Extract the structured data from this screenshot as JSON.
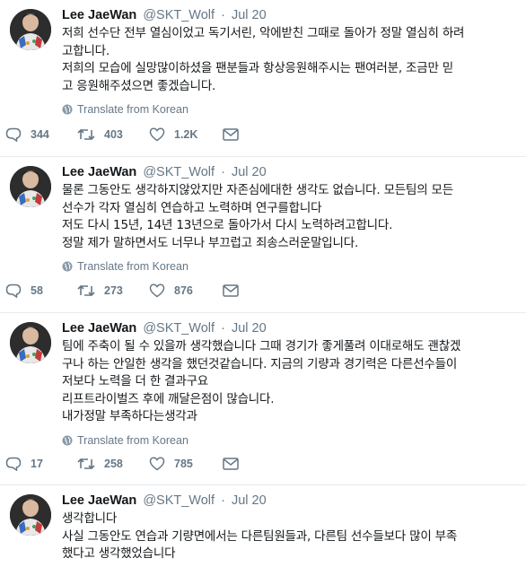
{
  "tweets": [
    {
      "name": "Lee JaeWan",
      "handle": "@SKT_Wolf",
      "dot": "·",
      "date": "Jul 20",
      "lines": [
        "저희 선수단 전부 열심이었고 독기서린, 악에받친 그때로 돌아가 정말 열심히 하려",
        "고합니다.",
        "저희의 모습에 실망많이하셨을 팬분들과 항상응원해주시는 팬여러분, 조금만 믿",
        "고 응원해주셨으면 좋겠습니다."
      ],
      "translate": "Translate from Korean",
      "replies": "344",
      "retweets": "403",
      "likes": "1.2K"
    },
    {
      "name": "Lee JaeWan",
      "handle": "@SKT_Wolf",
      "dot": "·",
      "date": "Jul 20",
      "lines": [
        "물론 그동안도 생각하지않았지만 자존심에대한 생각도 없습니다. 모든팀의 모든",
        "선수가 각자 열심히 연습하고 노력하며 연구를합니다",
        "저도 다시 15년, 14년 13년으로 돌아가서 다시 노력하려고합니다.",
        "정말 제가 말하면서도 너무나 부끄럽고 죄송스러운말입니다."
      ],
      "translate": "Translate from Korean",
      "replies": "58",
      "retweets": "273",
      "likes": "876"
    },
    {
      "name": "Lee JaeWan",
      "handle": "@SKT_Wolf",
      "dot": "·",
      "date": "Jul 20",
      "lines": [
        "팀에 주축이 될 수 있을까 생각했습니다 그때 경기가 좋게풀려 이대로해도 괜찮겠",
        "구나 하는 안일한 생각을 했던것같습니다. 지금의 기량과 경기력은 다른선수들이",
        "저보다 노력을 더 한 결과구요",
        "리프트라이벌즈 후에 깨달은점이 많습니다.",
        "내가정말 부족하다는생각과"
      ],
      "translate": "Translate from Korean",
      "replies": "17",
      "retweets": "258",
      "likes": "785"
    },
    {
      "name": "Lee JaeWan",
      "handle": "@SKT_Wolf",
      "dot": "·",
      "date": "Jul 20",
      "lines": [
        "생각합니다",
        "사실 그동안도 연습과 기량면에서는 다른팀원들과, 다른팀 선수들보다 많이 부족",
        "했다고 생각했었습니다"
      ]
    }
  ],
  "icons": {
    "reply": "reply-icon",
    "retweet": "retweet-icon",
    "like": "heart-icon",
    "dm": "envelope-icon",
    "translate": "globe-icon"
  },
  "colors": {
    "text": "#14171a",
    "muted": "#657786",
    "divider": "#e6ecf0"
  }
}
